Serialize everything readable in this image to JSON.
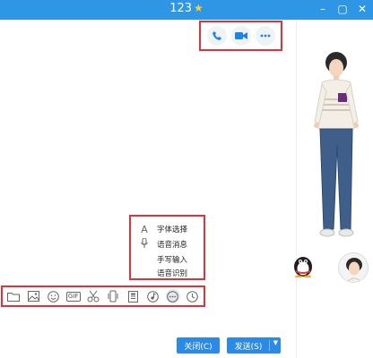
{
  "window": {
    "title": "123",
    "title_badge_icon": "star-icon",
    "controls": [
      "minimize-icon",
      "maximize-icon",
      "close-icon"
    ]
  },
  "top_actions": [
    "phone-icon",
    "video-camera-icon",
    "more-icon"
  ],
  "menu": {
    "items": [
      {
        "icon": "font-icon",
        "glyph": "A",
        "label": "字体选择"
      },
      {
        "icon": "microphone-icon",
        "glyph": "🎙",
        "label": "语音消息"
      },
      {
        "icon": "",
        "glyph": "",
        "label": "手写输入"
      },
      {
        "icon": "",
        "glyph": "",
        "label": "语音识别"
      }
    ]
  },
  "toolbar": {
    "icons": [
      "folder-icon",
      "image-icon",
      "emoji-icon",
      "gif-icon",
      "scissors-icon",
      "shake-icon",
      "document-icon",
      "music-icon",
      "more-icon",
      "clock-icon"
    ],
    "gif_label": "GIF"
  },
  "actions": {
    "close_label": "关闭(C)",
    "send_label": "发送(S)"
  },
  "colors": {
    "titlebar": "#2f96e6",
    "button": "#2b8ae6",
    "highlight_border": "#e0323a"
  }
}
